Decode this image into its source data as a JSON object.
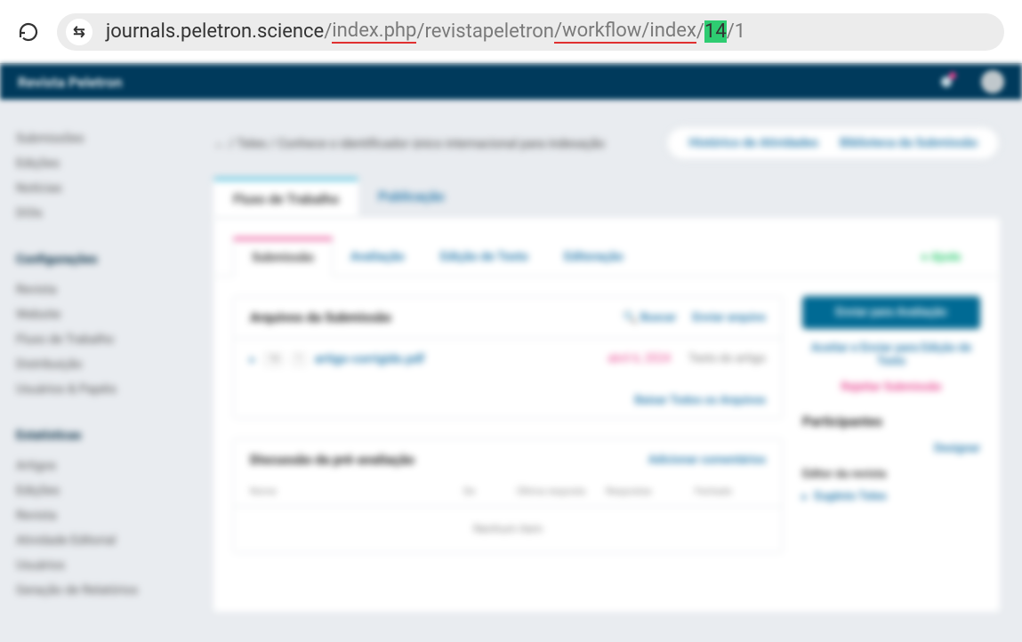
{
  "browser": {
    "url": {
      "host": "journals.peletron.science",
      "seg1": "/",
      "seg2": "index.php",
      "seg3": "/revistapeletron",
      "seg4": "/workflow/index",
      "seg5": "/",
      "seg6": "14",
      "seg7": "/1"
    }
  },
  "app": {
    "brand": "Revista Peletron",
    "sidebar": {
      "g1": {
        "items": [
          "Submissões",
          "Edições",
          "Notícias",
          "DOIs"
        ]
      },
      "g2": {
        "heading": "Configurações",
        "items": [
          "Revista",
          "Website",
          "Fluxo de Trabalho",
          "Distribuição",
          "Usuários & Papéis"
        ]
      },
      "g3": {
        "heading": "Estatísticas",
        "items": [
          "Artigos",
          "Edições",
          "Revista",
          "Atividade Editorial",
          "Usuários",
          "Geração de Relatórios"
        ]
      }
    },
    "breadcrumb": {
      "text": "← / Teles / Conhece o identificador único internacional para indexação",
      "actions": [
        "Histórico de Atividades",
        "Biblioteca da Submissão"
      ]
    },
    "tabs": {
      "workflow": "Fluxo de Trabalho",
      "publication": "Publicação"
    },
    "inner_tabs": [
      "Submissão",
      "Avaliação",
      "Edição de Texto",
      "Editoração"
    ],
    "help": "Ajuda",
    "files": {
      "title": "Arquivos da Submissão",
      "search": "Buscar",
      "upload": "Enviar arquivo",
      "row": {
        "name": "artigo-corrigido.pdf",
        "badges": [
          "14",
          "1"
        ],
        "date": "abril 6, 2024",
        "type": "Texto do artigo"
      },
      "download_all": "Baixar Todos os Arquivos"
    },
    "actions": {
      "primary": "Enviar para Avaliação",
      "accept_skip": "Aceitar e Enviar para Edição de Texto",
      "reject": "Rejeitar Submissão"
    },
    "participants": {
      "title": "Participantes",
      "assign": "Designar",
      "sub": "Editor da revista",
      "item": "Eugênio Teles"
    },
    "discussion": {
      "title": "Discussão da pré-avaliação",
      "add": "Adicionar comentários",
      "cols": [
        "Nome",
        "De",
        "Última resposta",
        "Respostas",
        "Fechado"
      ],
      "empty": "Nenhum item"
    }
  }
}
